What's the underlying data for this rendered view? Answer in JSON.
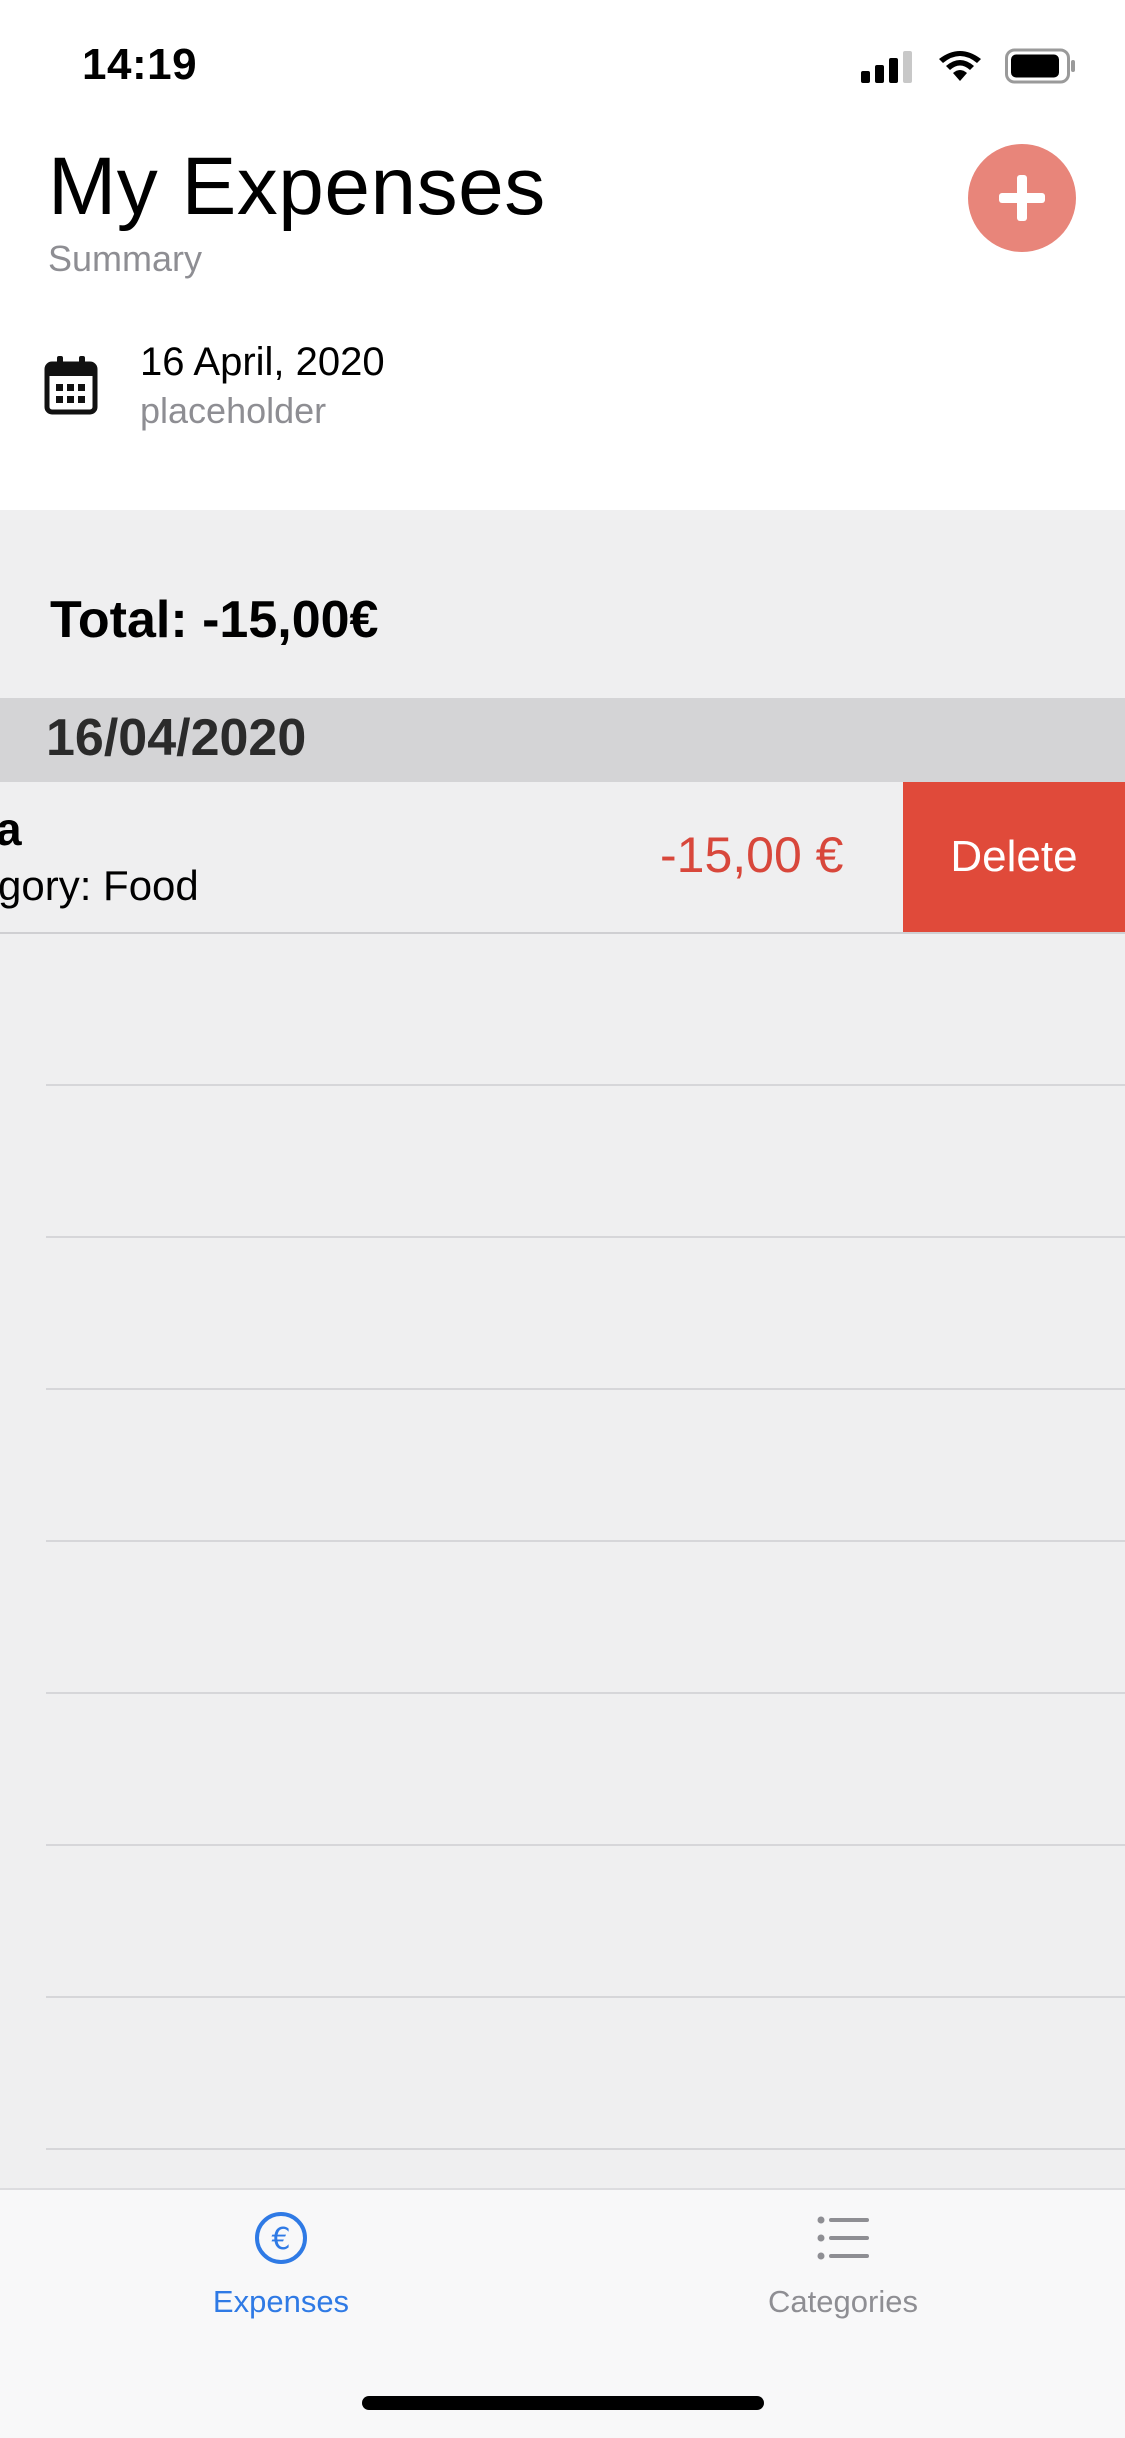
{
  "status_bar": {
    "time": "14:19"
  },
  "header": {
    "title": "My Expenses",
    "subtitle": "Summary",
    "add_icon": "plus-icon"
  },
  "date_row": {
    "date": "16 April, 2020",
    "subtitle": "placeholder",
    "icon": "calendar-icon"
  },
  "summary": {
    "total": "Total: -15,00€"
  },
  "list": {
    "section_title": "16/04/2020",
    "items": [
      {
        "name": "a",
        "category": "gory: Food",
        "amount": "-15,00 €",
        "delete_label": "Delete"
      }
    ]
  },
  "tabbar": {
    "tabs": [
      {
        "label": "Expenses",
        "icon": "euro-icon",
        "active": true
      },
      {
        "label": "Categories",
        "icon": "list-icon",
        "active": false
      }
    ]
  },
  "colors": {
    "accent": "#2f7ae5",
    "add_button": "#e8857a",
    "delete": "#e04a3a",
    "amount": "#d8473b"
  }
}
